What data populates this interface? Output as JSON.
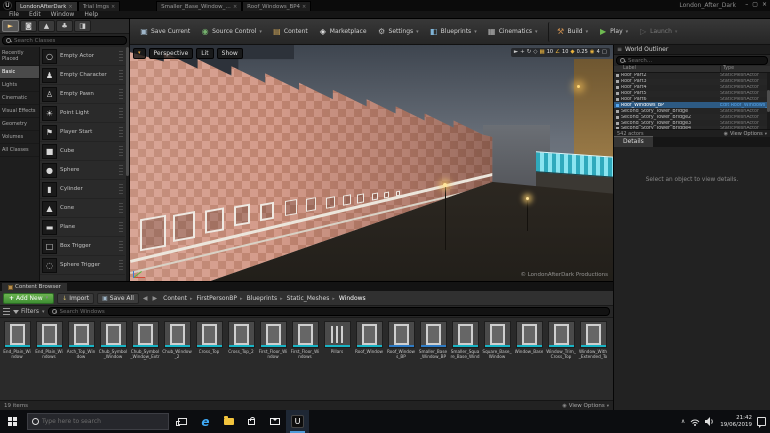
{
  "window": {
    "title": "London_After_Dark",
    "controls": {
      "minimize": "–",
      "maximize": "▢",
      "close": "×"
    }
  },
  "tabs": [
    {
      "label": "LondonAfterDark",
      "cls": "active"
    },
    {
      "label": "Trial Imgs"
    },
    {
      "label": "Smaller_Base_Window_BP",
      "cls": "gap-left"
    },
    {
      "label": "Roof_Windows_BP4"
    }
  ],
  "menu": {
    "items": [
      {
        "label": "File"
      },
      {
        "label": "Edit"
      },
      {
        "label": "Window"
      },
      {
        "label": "Help"
      }
    ]
  },
  "toolbar": {
    "buttons": [
      {
        "label": "Save Current",
        "icon": "save-current-icon",
        "cls": "tb-save"
      },
      {
        "label": "Source Control",
        "icon": "source-control-icon",
        "cls": "tb-source dd"
      },
      {
        "label": "Content",
        "icon": "content-icon",
        "cls": "tb-content"
      },
      {
        "label": "Marketplace",
        "icon": "marketplace-icon",
        "cls": "tb-market"
      },
      {
        "label": "Settings",
        "icon": "settings-icon",
        "cls": "tb-settings dd"
      },
      {
        "label": "Blueprints",
        "icon": "blueprints-icon",
        "cls": "tb-blueprints dd"
      },
      {
        "label": "Cinematics",
        "icon": "cinematics-icon",
        "cls": "tb-cinematics dd"
      },
      {
        "label": "Build",
        "icon": "build-icon",
        "cls": "tb-build dd sep-before"
      },
      {
        "label": "Play",
        "icon": "play-icon",
        "cls": "tb-play dd"
      },
      {
        "label": "Launch",
        "icon": "launch-icon",
        "cls": "tb-launch dd disabled"
      }
    ]
  },
  "modes": {
    "tools": [
      {
        "glyph": "►",
        "icon": "place-mode-icon",
        "cls": "active"
      },
      {
        "glyph": "◙",
        "icon": "paint-mode-icon"
      },
      {
        "glyph": "▲",
        "icon": "landscape-mode-icon"
      },
      {
        "glyph": "♣",
        "icon": "foliage-mode-icon"
      },
      {
        "glyph": "◨",
        "icon": "geometry-mode-icon"
      }
    ],
    "search_placeholder": "Search Classes",
    "categories": [
      {
        "label": "Recently Placed"
      },
      {
        "label": "Basic",
        "cls": "selected"
      },
      {
        "label": "Lights"
      },
      {
        "label": "Cinematic"
      },
      {
        "label": "Visual Effects"
      },
      {
        "label": "Geometry"
      },
      {
        "label": "Volumes"
      },
      {
        "label": "All Classes"
      }
    ],
    "items": [
      {
        "label": "Empty Actor",
        "glyph": "○"
      },
      {
        "label": "Empty Character",
        "glyph": "♟"
      },
      {
        "label": "Empty Pawn",
        "glyph": "♙"
      },
      {
        "label": "Point Light",
        "glyph": "☀"
      },
      {
        "label": "Player Start",
        "glyph": "⚑"
      },
      {
        "label": "Cube",
        "glyph": "■"
      },
      {
        "label": "Sphere",
        "glyph": "●"
      },
      {
        "label": "Cylinder",
        "glyph": "▮"
      },
      {
        "label": "Cone",
        "glyph": "▲"
      },
      {
        "label": "Plane",
        "glyph": "▬"
      },
      {
        "label": "Box Trigger",
        "glyph": "□"
      },
      {
        "label": "Sphere Trigger",
        "glyph": "◌"
      }
    ]
  },
  "viewport": {
    "perspective_label": "Perspective",
    "lit_label": "Lit",
    "show_label": "Show",
    "watermark": "© LondonAfterDark Productions",
    "snap": {
      "grid": "10",
      "rotation": "10",
      "scale": "0.25",
      "camera_speed": "4"
    }
  },
  "outliner": {
    "title": "World Outliner",
    "search_placeholder": "Search...",
    "columns": {
      "label": "Label",
      "type": "Type"
    },
    "rows": [
      {
        "label": "Roof_Part2",
        "type": "StaticMeshActor"
      },
      {
        "label": "Roof_Part3",
        "type": "StaticMeshActor"
      },
      {
        "label": "Roof_Part4",
        "type": "StaticMeshActor"
      },
      {
        "label": "Roof_Part5",
        "type": "StaticMeshActor"
      },
      {
        "label": "Roof_Part6",
        "type": "StaticMeshActor"
      },
      {
        "label": "Roof_Windows_BP",
        "type": "Edit Roof_Windows_BP",
        "cls": "selected bp"
      },
      {
        "label": "Second_Story_Tower_Bridge",
        "type": "StaticMeshActor"
      },
      {
        "label": "Second_Story_Tower_Bridge2",
        "type": "StaticMeshActor"
      },
      {
        "label": "Second_Story_Tower_Bridge3",
        "type": "StaticMeshActor"
      },
      {
        "label": "Second_Story_Tower_Bridge4",
        "type": "StaticMeshActor"
      }
    ],
    "footer": {
      "count": "542 actors",
      "view_options": "View Options"
    }
  },
  "details": {
    "title": "Details",
    "empty_message": "Select an object to view details."
  },
  "content_browser": {
    "tab": "Content Browser",
    "add_new": "Add New",
    "import": "Import",
    "save_all": "Save All",
    "breadcrumbs": [
      {
        "label": "Content"
      },
      {
        "label": "FirstPersonBP"
      },
      {
        "label": "Blueprints"
      },
      {
        "label": "Static_Meshes"
      },
      {
        "label": "Windows"
      }
    ],
    "filters_label": "Filters",
    "search_placeholder": "Search Windows",
    "assets": [
      {
        "label": "End_Plain_Window",
        "cls": "sm"
      },
      {
        "label": "End_Plain_Windows",
        "cls": "sm"
      },
      {
        "label": "Arch_Top_Window",
        "cls": "sm"
      },
      {
        "label": "Chub_Symbol_Window",
        "cls": "sm"
      },
      {
        "label": "Chub_Symbol_Window_Extra_Top",
        "cls": "sm"
      },
      {
        "label": "Chub_Window_2",
        "cls": "sm"
      },
      {
        "label": "Cross_Top",
        "cls": "sm"
      },
      {
        "label": "Cross_Top_2",
        "cls": "sm"
      },
      {
        "label": "First_Floor_Window",
        "cls": "sm"
      },
      {
        "label": "First_Floor_Windows",
        "cls": "sm"
      },
      {
        "label": "Pillars",
        "cls": "sm"
      },
      {
        "label": "Roof_Window",
        "cls": "sm"
      },
      {
        "label": "Roof_Windows_BP",
        "cls": "bp"
      },
      {
        "label": "Smaller_Base_Window_BP",
        "cls": "bp"
      },
      {
        "label": "Smaller_Square_Base_Window",
        "cls": "sm"
      },
      {
        "label": "Square_Base_Window",
        "cls": "sm"
      },
      {
        "label": "Window_Base",
        "cls": "sm"
      },
      {
        "label": "Window_Trim_Cross_Top",
        "cls": "sm"
      },
      {
        "label": "Window_With_Extended_Top",
        "cls": "sm"
      }
    ],
    "footer": {
      "count": "19 items",
      "view_options": "View Options"
    }
  },
  "taskbar": {
    "search_placeholder": "Type here to search",
    "apps": [
      {
        "icon": "task-view-icon",
        "cls": "taskview"
      },
      {
        "glyph": "e",
        "icon": "edge-icon",
        "cls": "edge"
      },
      {
        "icon": "file-explorer-icon",
        "cls": "explorer"
      },
      {
        "icon": "store-icon",
        "cls": "store"
      },
      {
        "icon": "mail-icon",
        "cls": "mail"
      },
      {
        "glyph": "U",
        "icon": "unreal-editor-icon",
        "cls": "ue active"
      }
    ],
    "clock": {
      "time": "21:42",
      "date": "19/06/2019"
    }
  },
  "colors": {
    "accent_orange": "#e8a33d",
    "add_new_green": "#4a9e3f",
    "play_green": "#6fba51",
    "selection_blue": "#2d5a83",
    "blueprint_blue": "#2e7bc4",
    "staticmesh_cyan": "#18b3c4",
    "building_pink": "#d49b8a"
  }
}
